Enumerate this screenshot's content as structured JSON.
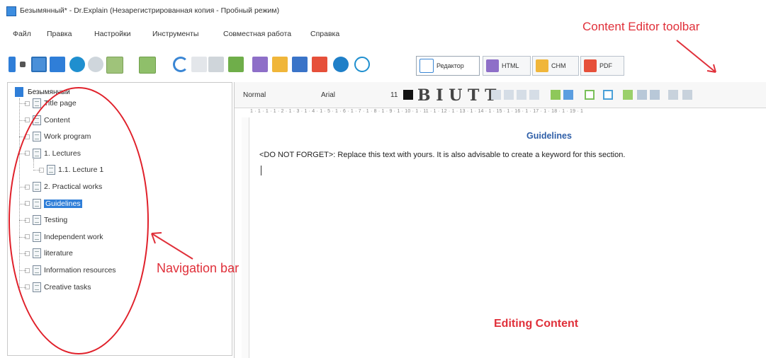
{
  "window": {
    "title": "Безымянный* - Dr.Explain (Незарегистрированная копия - Пробный режим)"
  },
  "menu": [
    "Файл",
    "Правка",
    "Настройки",
    "Инструменты",
    "Совместная работа",
    "Справка"
  ],
  "view_tabs": [
    {
      "label": "Редактор",
      "active": true
    },
    {
      "label": "HTML",
      "active": false
    },
    {
      "label": "CHM",
      "active": false
    },
    {
      "label": "PDF",
      "active": false
    }
  ],
  "format_bar": {
    "style": "Normal",
    "font": "Arial",
    "size": "11",
    "glyphs": "B I U T T"
  },
  "ruler_text": "1 · 1 · 1 · 1 · 2 · 1 · 3 · 1 · 4 · 1 · 5 · 1 · 6 · 1 · 7 · 1 · 8 · 1 · 9 · 1 · 10 · 1 · 11 · 1 · 12 · 1 · 13 · 1 · 14 · 1 · 15 · 1 · 16 · 1 · 17 · 1 · 18 · 1 · 19 · 1",
  "tree": {
    "root": "Безымянный",
    "items": [
      {
        "label": "Title page",
        "depth": 1,
        "selected": false
      },
      {
        "label": "Content",
        "depth": 1,
        "selected": false
      },
      {
        "label": "Work program",
        "depth": 1,
        "selected": false
      },
      {
        "label": "1. Lectures",
        "depth": 1,
        "selected": false
      },
      {
        "label": "1.1. Lecture 1",
        "depth": 2,
        "selected": false
      },
      {
        "label": "2. Practical works",
        "depth": 1,
        "selected": false
      },
      {
        "label": "Guidelines",
        "depth": 1,
        "selected": true
      },
      {
        "label": "Testing",
        "depth": 1,
        "selected": false
      },
      {
        "label": "Independent work",
        "depth": 1,
        "selected": false
      },
      {
        "label": "literature",
        "depth": 1,
        "selected": false
      },
      {
        "label": "Information resources",
        "depth": 1,
        "selected": false
      },
      {
        "label": "Creative tasks",
        "depth": 1,
        "selected": false
      }
    ]
  },
  "document": {
    "heading": "Guidelines",
    "body": "<DO NOT FORGET>: Replace this text with yours. It is also advisable to create a keyword for this section."
  },
  "annotations": {
    "toolbar": "Content Editor toolbar",
    "navigation": "Navigation bar",
    "editing": "Editing Content"
  },
  "colors": {
    "accent_red": "#e0303a",
    "heading_blue": "#2f5fa8",
    "selection_blue": "#2f7ed8"
  }
}
